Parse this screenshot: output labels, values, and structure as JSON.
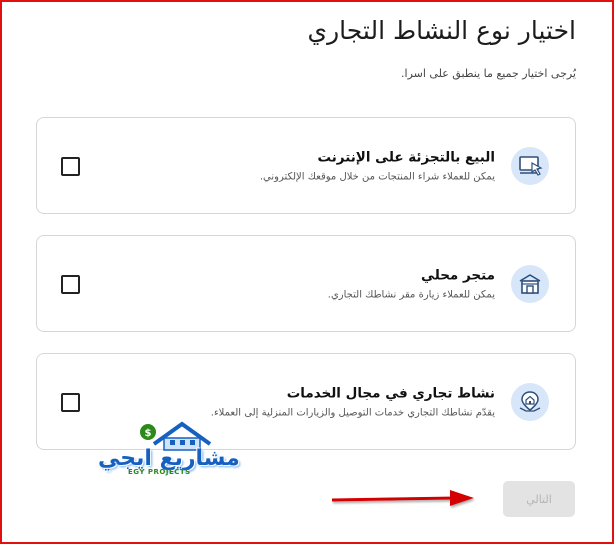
{
  "header": {
    "title": "اختيار نوع النشاط التجاري",
    "subtitle": "يُرجى اختيار جميع ما ينطبق على اسرا."
  },
  "options": [
    {
      "title": "البيع بالتجزئة على الإنترنت",
      "description": "يمكن للعملاء شراء المنتجات من خلال موقعك الإلكتروني.",
      "icon": "monitor-cursor-icon",
      "checked": false
    },
    {
      "title": "متجر محلي",
      "description": "يمكن للعملاء زيارة مقر نشاطك التجاري.",
      "icon": "storefront-icon",
      "checked": false
    },
    {
      "title": "نشاط تجاري في مجال الخدمات",
      "description": "يقدّم نشاطك التجاري خدمات التوصيل والزيارات المنزلية إلى العملاء.",
      "icon": "house-location-icon",
      "checked": false
    }
  ],
  "footer": {
    "next_label": "التالي"
  },
  "watermark": {
    "arabic": "مشاريع ايجي",
    "english": "EGY PROJECTS"
  },
  "colors": {
    "frame_border": "#e01010",
    "icon_bg": "#d7e6f8",
    "icon_stroke": "#2d4f7c",
    "button_disabled_bg": "#e3e3e3",
    "button_disabled_text": "#b5b5b5",
    "annotation_arrow": "#d40000",
    "watermark_blue": "#1660c0",
    "watermark_green": "#2b8a1a"
  }
}
